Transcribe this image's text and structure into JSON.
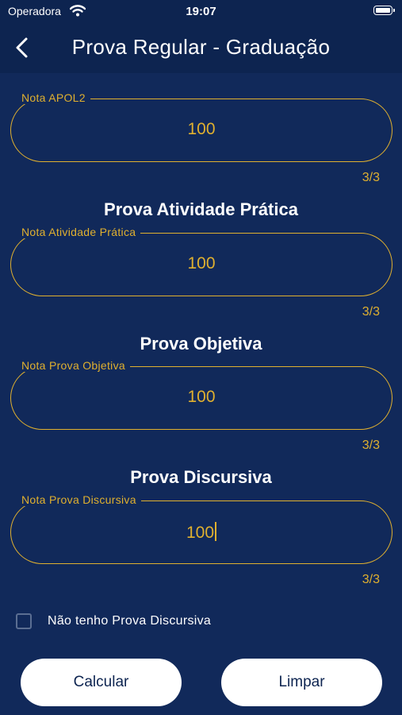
{
  "status": {
    "carrier": "Operadora",
    "time": "19:07"
  },
  "nav": {
    "title": "Prova Regular - Graduação"
  },
  "sections": {
    "apol": {
      "field_label": "Nota APOL2",
      "value": "100",
      "counter": "3/3"
    },
    "pratica": {
      "title": "Prova Atividade Prática",
      "field_label": "Nota Atividade Prática",
      "value": "100",
      "counter": "3/3"
    },
    "objetiva": {
      "title": "Prova Objetiva",
      "field_label": "Nota Prova Objetiva",
      "value": "100",
      "counter": "3/3"
    },
    "discursiva": {
      "title": "Prova Discursiva",
      "field_label": "Nota Prova Discursiva",
      "value": "100",
      "counter": "3/3"
    }
  },
  "checkbox": {
    "label": "Não tenho Prova Discursiva",
    "checked": false
  },
  "buttons": {
    "calcular": "Calcular",
    "limpar": "Limpar"
  },
  "colors": {
    "background": "#11295a",
    "header": "#0d2450",
    "accent": "#e0b02f",
    "button_bg": "#ffffff"
  },
  "icons": {
    "back": "chevron-left-icon",
    "wifi": "wifi-icon",
    "battery": "battery-icon"
  }
}
